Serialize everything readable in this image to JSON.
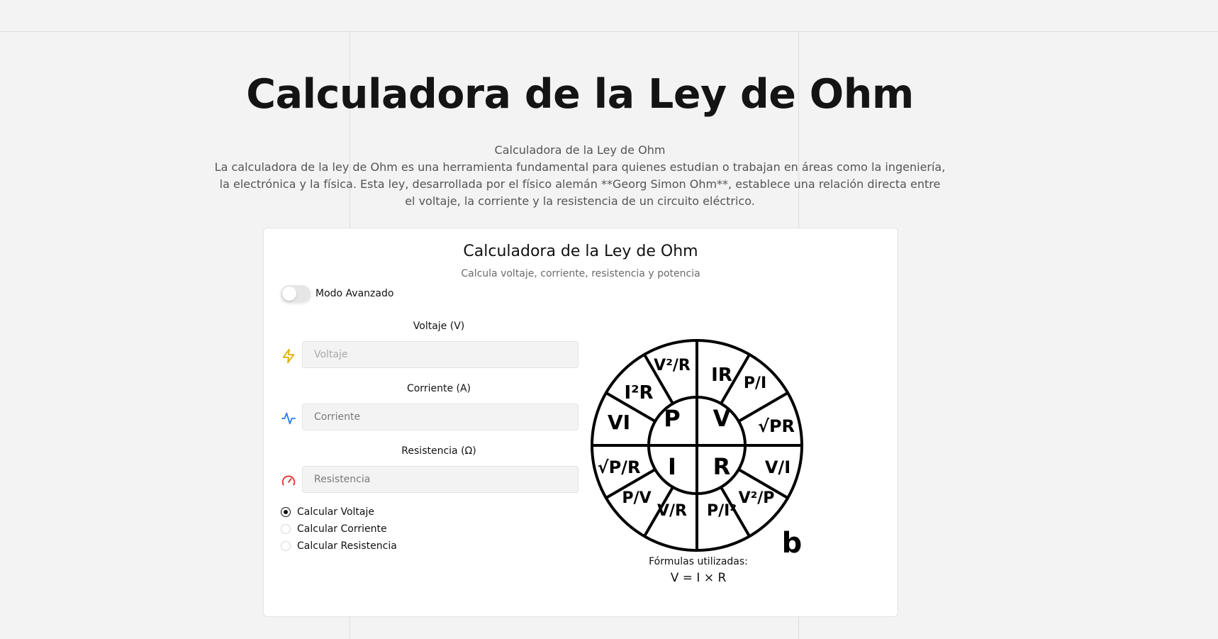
{
  "page": {
    "title": "Calculadora de la Ley de Ohm",
    "intro_heading": "Calculadora de la Ley de Ohm",
    "intro_text": "La calculadora de la ley de Ohm es una herramienta fundamental para quienes estudian o trabajan en áreas como la ingeniería, la electrónica y la física. Esta ley, desarrollada por el físico alemán **Georg Simon Ohm**, establece una relación directa entre el voltaje, la corriente y la resistencia de un circuito eléctrico."
  },
  "calculator": {
    "title": "Calculadora de la Ley de Ohm",
    "subtitle": "Calcula voltaje, corriente, resistencia y potencia",
    "advanced_mode": {
      "label": "Modo Avanzado",
      "enabled": false
    },
    "fields": [
      {
        "label": "Voltaje (V)",
        "placeholder": "Voltaje",
        "value": "",
        "icon": "lightning-bolt-icon",
        "icon_color": "#e0b000"
      },
      {
        "label": "Corriente (A)",
        "placeholder": "Corriente",
        "value": "",
        "icon": "pulse-wave-icon",
        "icon_color": "#2b7de9"
      },
      {
        "label": "Resistencia (Ω)",
        "placeholder": "Resistencia",
        "value": "",
        "icon": "gauge-icon",
        "icon_color": "#e0322f"
      }
    ],
    "calc_options": [
      {
        "label": "Calcular Voltaje",
        "selected": true
      },
      {
        "label": "Calcular Corriente",
        "selected": false
      },
      {
        "label": "Calcular Resistencia",
        "selected": false
      }
    ],
    "wheel": {
      "center": [
        "P",
        "V",
        "I",
        "R"
      ],
      "outer": [
        "V²/R",
        "IR",
        "P/I",
        "√PR",
        "V/I",
        "V²/P",
        "P/I²",
        "V/R",
        "P/V",
        "√P/R",
        "VI",
        "I²R"
      ],
      "corner_label": "b"
    },
    "formulas_label": "Fórmulas utilizadas:",
    "formula": "V = I × R"
  }
}
